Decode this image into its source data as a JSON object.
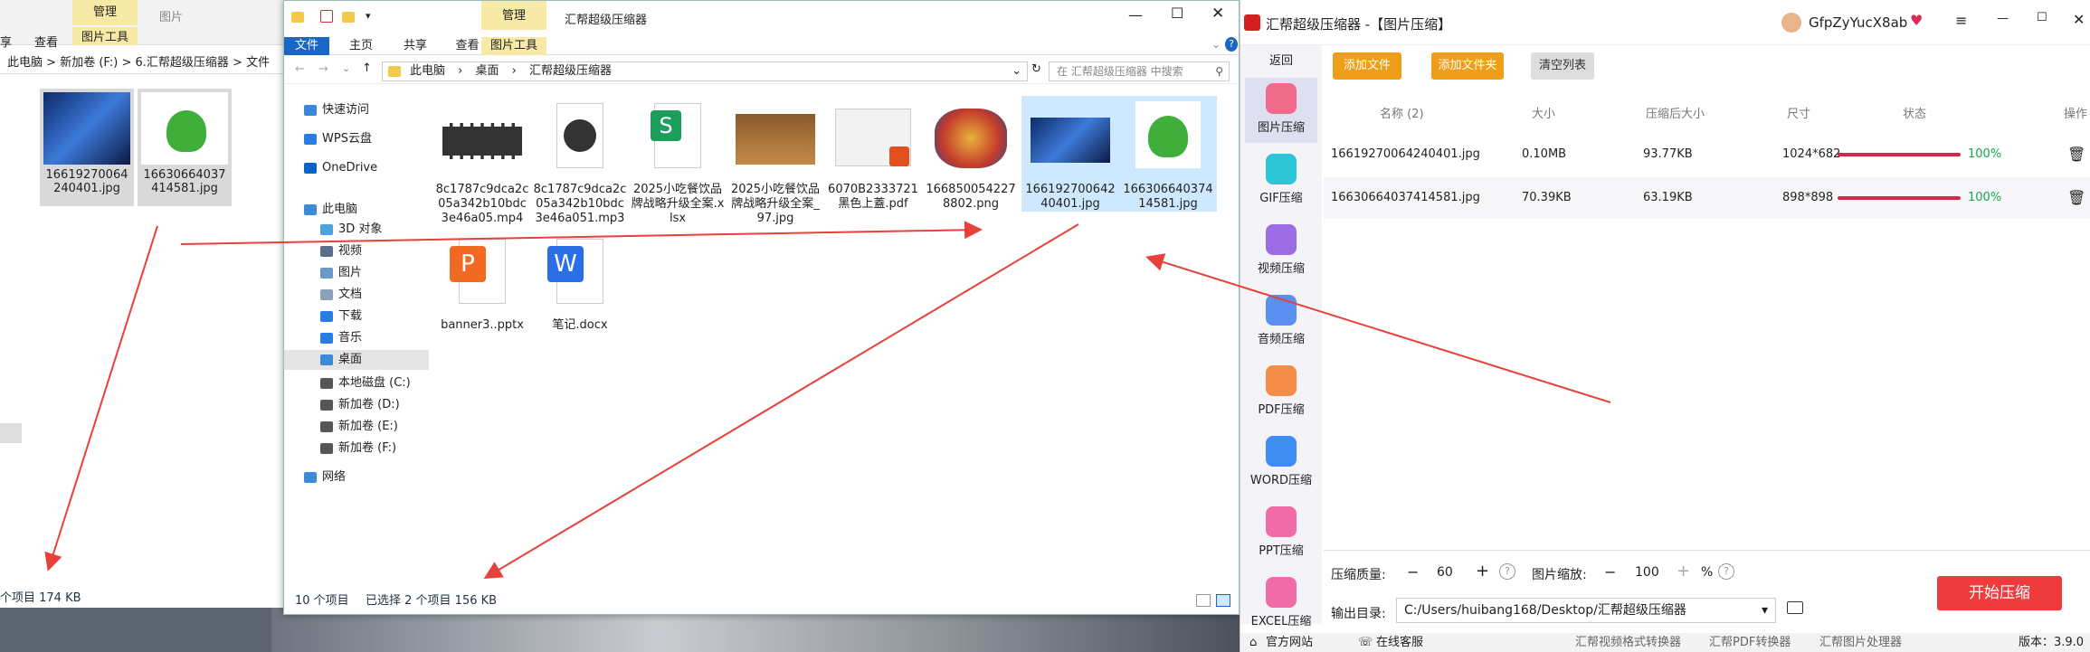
{
  "back_window": {
    "ribbon_tabs": [
      "享",
      "查看",
      "图片工具",
      "图片"
    ],
    "manage_label": "管理",
    "address_parts": [
      "此电脑",
      "新加卷 (F:)",
      "6.汇帮超级压缩器",
      "文件"
    ],
    "thumbs": [
      {
        "name": "16619270064240401.jpg"
      },
      {
        "name": "16630664037414581.jpg"
      }
    ],
    "status": "个项目   174 KB"
  },
  "explorer": {
    "title": "汇帮超级压缩器",
    "manage_label": "管理",
    "tabs": [
      "文件",
      "主页",
      "共享",
      "查看",
      "图片工具"
    ],
    "address": [
      "此电脑",
      "桌面",
      "汇帮超级压缩器"
    ],
    "search_placeholder": "在 汇帮超级压缩器 中搜索",
    "sidebar": [
      {
        "label": "快速访问",
        "icon": "star-icon",
        "color": "#3a86d8"
      },
      {
        "label": "WPS云盘",
        "icon": "cloud-icon",
        "color": "#2a7de1"
      },
      {
        "label": "OneDrive",
        "icon": "onedrive-icon",
        "color": "#0a64c8"
      },
      {
        "label": "此电脑",
        "icon": "computer-icon",
        "color": "#3b8ad9"
      },
      {
        "label": "3D 对象",
        "icon": "cube-icon",
        "color": "#4aa3df"
      },
      {
        "label": "视频",
        "icon": "video-icon",
        "color": "#5a6e8c"
      },
      {
        "label": "图片",
        "icon": "picture-icon",
        "color": "#6a9bc8"
      },
      {
        "label": "文档",
        "icon": "document-icon",
        "color": "#8aa0b8"
      },
      {
        "label": "下载",
        "icon": "download-icon",
        "color": "#2a7de1"
      },
      {
        "label": "音乐",
        "icon": "music-icon",
        "color": "#2a7de1"
      },
      {
        "label": "桌面",
        "icon": "desktop-icon",
        "color": "#3b8ad9"
      },
      {
        "label": "本地磁盘 (C:)",
        "icon": "drive-icon",
        "color": "#555"
      },
      {
        "label": "新加卷 (D:)",
        "icon": "drive-icon",
        "color": "#555"
      },
      {
        "label": "新加卷 (E:)",
        "icon": "drive-icon",
        "color": "#555"
      },
      {
        "label": "新加卷 (F:)",
        "icon": "drive-icon",
        "color": "#555"
      },
      {
        "label": "网络",
        "icon": "network-icon",
        "color": "#3b8ad9"
      }
    ],
    "files": [
      {
        "name": "8c1787c9dca2c05a342b10bdc3e46a05.mp4",
        "type": "video"
      },
      {
        "name": "8c1787c9dca2c05a342b10bdc3e46a051.mp3",
        "type": "audio"
      },
      {
        "name": "2025小吃餐饮品牌战略升级全案.xlsx",
        "type": "xlsx"
      },
      {
        "name": "2025小吃餐饮品牌战略升级全案_97.jpg",
        "type": "photo"
      },
      {
        "name": "6070B2333721黑色上蓋.pdf",
        "type": "pdf"
      },
      {
        "name": "1668500542278802.png",
        "type": "art"
      },
      {
        "name": "16619270064240401.jpg",
        "type": "blue",
        "selected": true
      },
      {
        "name": "16630664037414581.jpg",
        "type": "leaf",
        "selected": true
      },
      {
        "name": "banner3..pptx",
        "type": "pptx"
      },
      {
        "name": "笔记.docx",
        "type": "docx"
      }
    ],
    "status_count": "10 个项目",
    "status_selected": "已选择 2 个项目  156 KB"
  },
  "app": {
    "title": "汇帮超级压缩器  -【图片压缩】",
    "user": "GfpZyYucX8ab",
    "back_label": "返回",
    "nav": [
      {
        "label": "图片压缩",
        "icon": "image-compress-icon",
        "color": "#f06b8a",
        "active": true
      },
      {
        "label": "GIF压缩",
        "icon": "gif-icon",
        "color": "#2cc6d6"
      },
      {
        "label": "视频压缩",
        "icon": "video-compress-icon",
        "color": "#9b6ee6"
      },
      {
        "label": "音频压缩",
        "icon": "audio-compress-icon",
        "color": "#5b8ff0"
      },
      {
        "label": "PDF压缩",
        "icon": "pdf-compress-icon",
        "color": "#f58c4a"
      },
      {
        "label": "WORD压缩",
        "icon": "word-compress-icon",
        "color": "#3f8df0"
      },
      {
        "label": "PPT压缩",
        "icon": "ppt-compress-icon",
        "color": "#f06ba8"
      },
      {
        "label": "EXCEL压缩",
        "icon": "excel-compress-icon",
        "color": "#f06ba8"
      }
    ],
    "buttons": {
      "add_file": "添加文件",
      "add_folder": "添加文件夹",
      "clear_list": "清空列表"
    },
    "headers": [
      "名称 (2)",
      "大小",
      "压缩后大小",
      "尺寸",
      "状态",
      "操作"
    ],
    "rows": [
      {
        "name": "16619270064240401.jpg",
        "size": "0.10MB",
        "compressed": "93.77KB",
        "dims": "1024*682",
        "progress": 1.0,
        "progress_text": "100%"
      },
      {
        "name": "16630664037414581.jpg",
        "size": "70.39KB",
        "compressed": "63.19KB",
        "dims": "898*898",
        "progress": 1.0,
        "progress_text": "100%"
      }
    ],
    "quality_label": "压缩质量:",
    "quality_value": "60",
    "scale_label": "图片缩放:",
    "scale_value": "100",
    "scale_unit": "%",
    "output_label": "输出目录:",
    "output_path": "C:/Users/huibang168/Desktop/汇帮超级压缩器",
    "start_button": "开始压缩",
    "footer": {
      "website": "官方网站",
      "service": "在线客服",
      "links": [
        "汇帮视频格式转换器",
        "汇帮PDF转换器",
        "汇帮图片处理器"
      ],
      "version": "版本：3.9.0"
    },
    "accent": "#ef9e1a",
    "start_color": "#ef3b3b"
  },
  "arrow_color": "#e8403a"
}
